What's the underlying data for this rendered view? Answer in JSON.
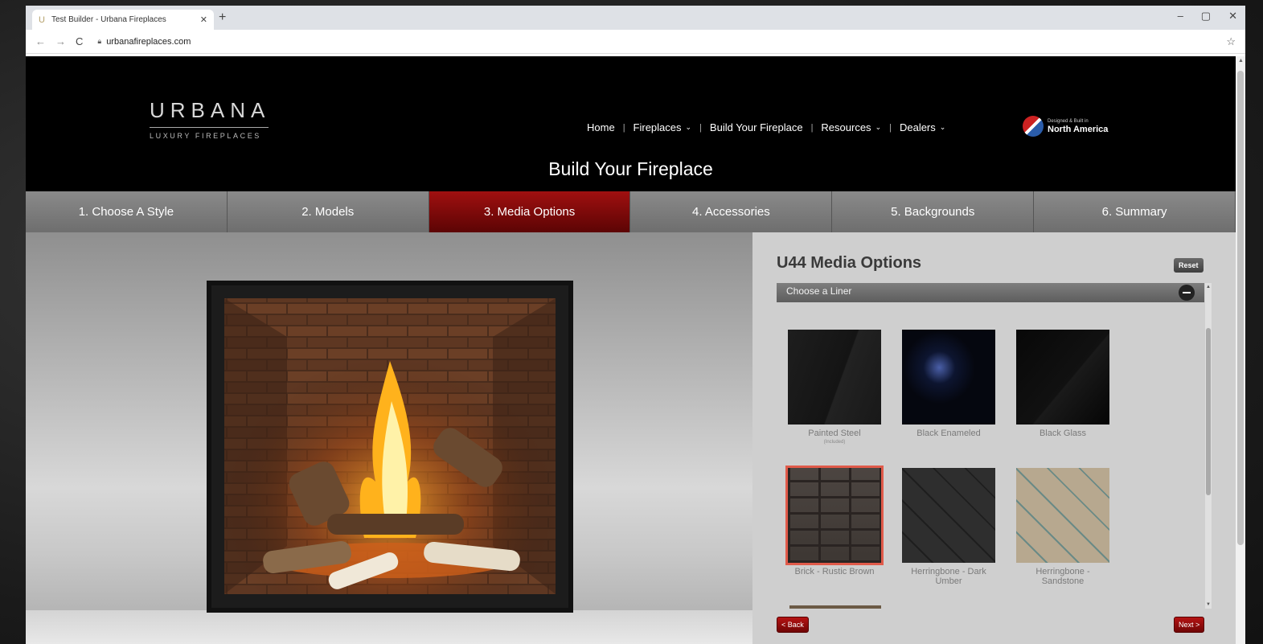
{
  "browser": {
    "tab_title": "Test Builder - Urbana Fireplaces",
    "tab_favicon": "U",
    "tab_close": "✕",
    "new_tab": "+",
    "url": "urbanafireplaces.com",
    "window_controls": [
      "–",
      "▢",
      "✕"
    ]
  },
  "site": {
    "logo": {
      "brand": "URBANA",
      "tagline": "LUXURY FIREPLACES"
    },
    "nav": [
      {
        "label": "Home",
        "has_dropdown": false
      },
      {
        "label": "Fireplaces",
        "has_dropdown": true
      },
      {
        "label": "Build Your Fireplace",
        "has_dropdown": false
      },
      {
        "label": "Resources",
        "has_dropdown": true
      },
      {
        "label": "Dealers",
        "has_dropdown": true
      }
    ],
    "badge": {
      "line1": "Designed & Built in",
      "line2": "North America"
    },
    "page_title": "Build Your Fireplace",
    "steps": [
      {
        "label": "1. Choose A Style",
        "active": false
      },
      {
        "label": "2. Models",
        "active": false
      },
      {
        "label": "3. Media Options",
        "active": true
      },
      {
        "label": "4. Accessories",
        "active": false
      },
      {
        "label": "5. Backgrounds",
        "active": false
      },
      {
        "label": "6. Summary",
        "active": false
      }
    ]
  },
  "panel": {
    "title": "U44 Media Options",
    "reset_label": "Reset",
    "section_label": "Choose a Liner",
    "back_label": "< Back",
    "next_label": "Next >",
    "liners": [
      {
        "label": "Painted Steel",
        "note": "(Included)",
        "selected": false
      },
      {
        "label": "Black Enameled",
        "note": "",
        "selected": false
      },
      {
        "label": "Black Glass",
        "note": "",
        "selected": false
      },
      {
        "label": "Brick - Rustic Brown",
        "note": "",
        "selected": true
      },
      {
        "label": "Herringbone - Dark Umber",
        "note": "",
        "selected": false
      },
      {
        "label": "Herringbone - Sandstone",
        "note": "",
        "selected": false
      }
    ]
  },
  "colors": {
    "accent_red": "#9a0c0c",
    "selected_outline": "#e05a4a",
    "step_bg": "#777777"
  }
}
